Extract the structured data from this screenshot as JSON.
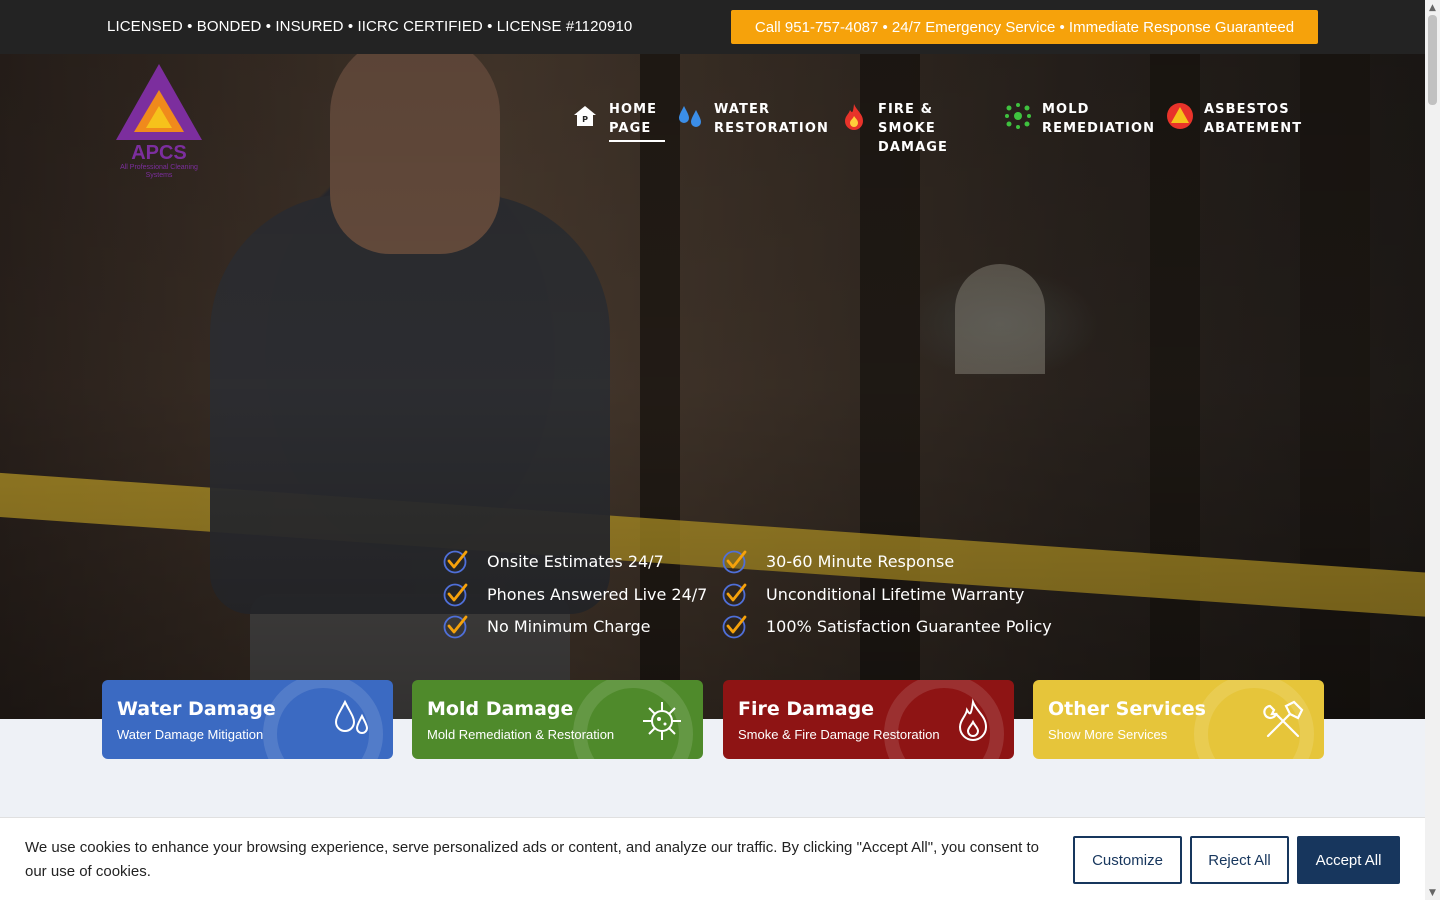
{
  "topbar": {
    "license_text": "LICENSED • BONDED • INSURED • IICRC CERTIFIED • LICENSE #1120910",
    "call_button": "Call 951-757-4087 • 24/7 Emergency Service • Immediate Response Guaranteed"
  },
  "logo": {
    "name": "APCS",
    "tagline": "All Professional Cleaning Systems"
  },
  "nav": [
    {
      "label": "HOME PAGE",
      "icon": "home-icon"
    },
    {
      "label": "WATER RESTORATION",
      "icon": "water-drops-icon"
    },
    {
      "label": "FIRE & SMOKE DAMAGE",
      "icon": "flame-icon"
    },
    {
      "label": "MOLD REMEDIATION",
      "icon": "mold-spores-icon"
    },
    {
      "label": "ASBESTOS ABATEMENT",
      "icon": "asbestos-warning-icon"
    }
  ],
  "checklist": [
    "Onsite Estimates 24/7",
    "Phones Answered Live 24/7",
    "No Minimum Charge",
    "30-60 Minute Response",
    "Unconditional Lifetime Warranty",
    "100% Satisfaction Guarantee Policy"
  ],
  "cards": [
    {
      "title": "Water Damage",
      "subtitle": "Water Damage Mitigation",
      "color": "#3b6ac2",
      "icon": "water-drops-icon"
    },
    {
      "title": "Mold Damage",
      "subtitle": "Mold Remediation & Restoration",
      "color": "#4f8a2b",
      "icon": "virus-icon"
    },
    {
      "title": "Fire Damage",
      "subtitle": "Smoke & Fire Damage Restoration",
      "color": "#8e1414",
      "icon": "flame-icon"
    },
    {
      "title": "Other Services",
      "subtitle": "Show More Services",
      "color": "#e6c53a",
      "icon": "tools-icon"
    }
  ],
  "cookie": {
    "message": "We use cookies to enhance your browsing experience, serve personalized ads or content, and analyze our traffic. By clicking \"Accept All\", you consent to our use of cookies.",
    "customize": "Customize",
    "reject": "Reject All",
    "accept": "Accept All"
  },
  "colors": {
    "accent_orange": "#f6a20b",
    "navy": "#17365d",
    "check_gold": "#f6a20b",
    "check_blue": "#4f6fd8"
  }
}
